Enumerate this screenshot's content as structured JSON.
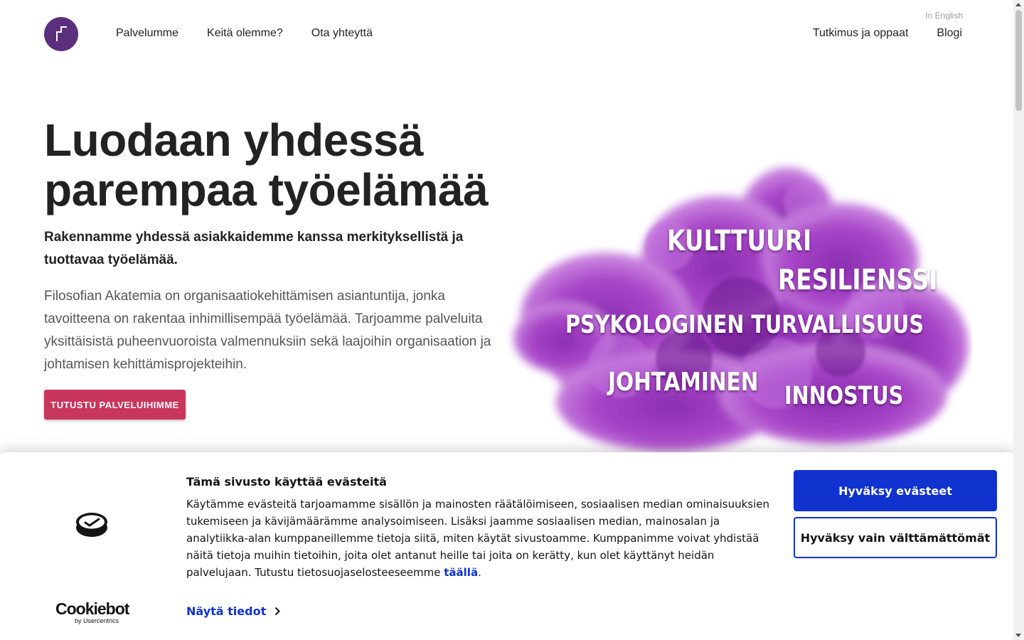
{
  "header": {
    "lang_link": "In English",
    "nav_left": [
      "Palvelumme",
      "Keitä olemme?",
      "Ota yhteyttä"
    ],
    "nav_right": [
      "Tutkimus ja oppaat",
      "Blogi"
    ]
  },
  "hero": {
    "title": "Luodaan yhdessä parempaa työelämää",
    "lead": "Rakennamme yhdessä asiakkaidemme kanssa merkityksellistä ja tuottavaa työelämää.",
    "body": "Filosofian Akatemia on organisaatiokehittämisen asiantuntija, jonka tavoitteena on rakentaa  inhimillisempää työelämää. Tarjoamme palveluita yksittäisistä puheenvuoroista valmennuksiin sekä laajoihin organisaation ja johtamisen kehittämisprojekteihin.",
    "cta": "TUTUSTU PALVELUIHIMME",
    "cloud_words": [
      "KULTTUURI",
      "RESILIENSSI",
      "PSYKOLOGINEN TURVALLISUUS",
      "JOHTAMINEN",
      "INNOSTUS"
    ]
  },
  "cookie": {
    "title": "Tämä sivusto käyttää evästeitä",
    "text": "Käytämme evästeitä tarjoamamme sisällön ja mainosten räätälöimiseen, sosiaalisen median ominaisuuksien tukemiseen ja kävijämäärämme analysoimiseen. Lisäksi jaamme sosiaalisen median, mainosalan ja analytiikka-alan kumppaneillemme tietoja siitä, miten käytät sivustoamme. Kumppanimme voivat yhdistää näitä tietoja muihin tietoihin, joita olet antanut heille tai joita on kerätty, kun olet käyttänyt heidän palvelujaan. Tutustu tietosuojaselosteeseemme",
    "link": "täällä",
    "link_suffix": ".",
    "details": "Näytä tiedot",
    "accept": "Hyväksy evästeet",
    "necessary": "Hyväksy vain välttämättömät",
    "brand": "Cookiebot",
    "brand_sub": "by Usercentrics"
  },
  "colors": {
    "brand_purple": "#5b2e7e",
    "cta_red": "#c8355d",
    "cookie_blue": "#1032cf"
  }
}
